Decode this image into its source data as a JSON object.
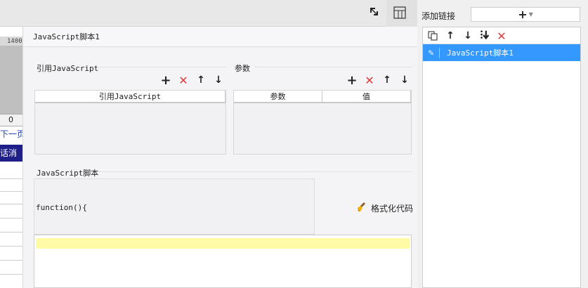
{
  "background": {
    "ruler_label": "1400",
    "zero_label": "0",
    "next_page": "下一页",
    "band_text": "话消费"
  },
  "dialog": {
    "title": "JavaScript脚本1",
    "ref_section_label": "引用JavaScript",
    "ref_columns": [
      "引用JavaScript"
    ],
    "param_section_label": "参数",
    "param_columns": [
      "参数",
      "值"
    ],
    "script_section_label": "JavaScript脚本",
    "code_text": "function(){",
    "format_label": "格式化代码",
    "toolbar_glyphs": {
      "add": "+",
      "delete": "✕",
      "up": "↑",
      "down": "↓"
    }
  },
  "right_panel": {
    "add_link_label": "添加链接",
    "add_glyph": "+",
    "items": [
      "JavaScript脚本1"
    ]
  },
  "colors": {
    "selected_item": "#3399ff",
    "delete_red": "#e03a3a",
    "highlight_line": "#fffaa5",
    "band_navy": "#1f1f8a"
  },
  "icons": [
    "expand-icon",
    "layout-icon",
    "copy-icon",
    "move-up-icon",
    "move-down-icon",
    "move-bottom-icon",
    "delete-icon",
    "edit-pencil-icon",
    "broom-icon"
  ]
}
